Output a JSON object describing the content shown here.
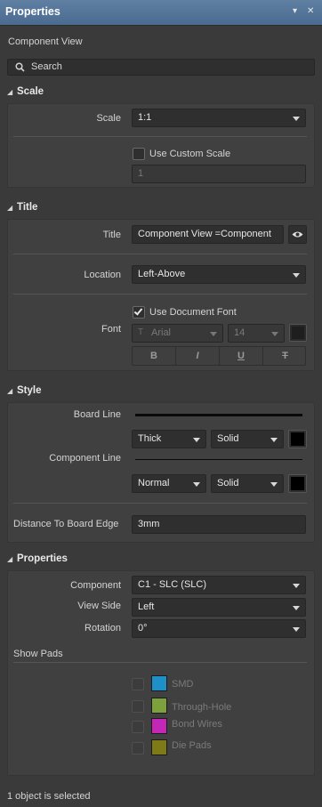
{
  "window": {
    "title": "Properties",
    "pin_glyph": "▾",
    "close_glyph": "✕"
  },
  "header": {
    "subtitle": "Component View"
  },
  "search": {
    "placeholder": "Search"
  },
  "scale": {
    "heading": "Scale",
    "scale_label": "Scale",
    "scale_value": "1:1",
    "custom_scale_label": "Use Custom Scale",
    "custom_scale_checked": false,
    "custom_scale_value": "1"
  },
  "title": {
    "heading": "Title",
    "title_label": "Title",
    "title_value": "Component View =Component",
    "location_label": "Location",
    "location_value": "Left-Above",
    "font_label": "Font",
    "use_doc_font_label": "Use Document Font",
    "use_doc_font_checked": true,
    "font_family": "Arial",
    "font_size": "14",
    "format_buttons": [
      "B",
      "I",
      "U",
      "T"
    ]
  },
  "style": {
    "heading": "Style",
    "board_line_label": "Board Line",
    "board_line_weight": "Thick",
    "board_line_style": "Solid",
    "component_line_label": "Component Line",
    "component_line_weight": "Normal",
    "component_line_style": "Solid",
    "distance_label": "Distance To Board Edge",
    "distance_value": "3mm"
  },
  "properties": {
    "heading": "Properties",
    "component_label": "Component",
    "component_value": "C1 - SLC (SLC)",
    "view_side_label": "View Side",
    "view_side_value": "Left",
    "rotation_label": "Rotation",
    "rotation_value": "0°",
    "show_pads_label": "Show Pads",
    "pads": [
      {
        "label": "SMD",
        "color": "#1e8fc7"
      },
      {
        "label": "Through-Hole",
        "color": "#7da23c"
      },
      {
        "label": "Bond Wires",
        "color": "#c427b5"
      },
      {
        "label": "Die Pads",
        "color": "#7f7a18"
      }
    ]
  },
  "status": {
    "text": "1 object is selected"
  },
  "colors": {
    "titlebar": "#4f6f94",
    "panel_bg": "#3a3a3a",
    "field_bg": "#2f2f2f",
    "swatch_black": "#000000"
  }
}
